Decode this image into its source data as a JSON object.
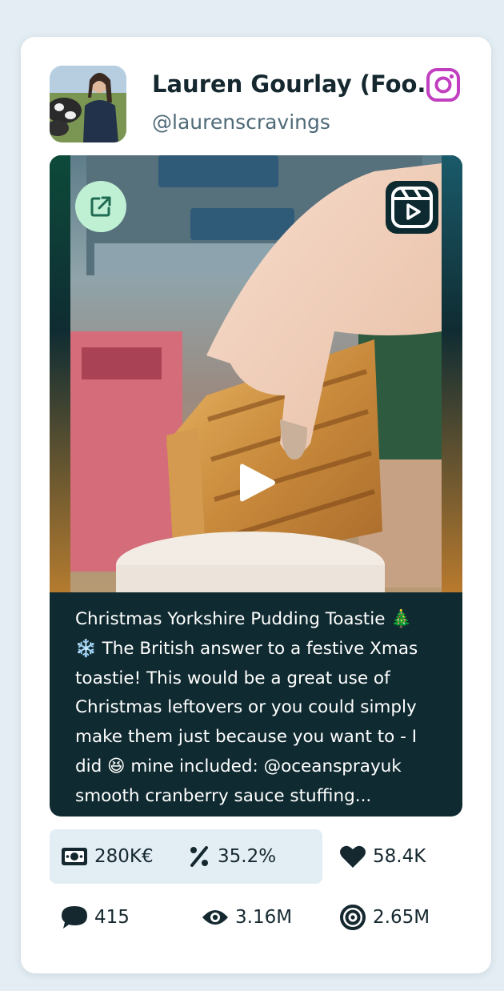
{
  "profile": {
    "name": "Lauren Gourlay (Foo...",
    "handle": "@laurenscravings",
    "platform_icon": "instagram-icon",
    "platform_color": "#c13ec0"
  },
  "media": {
    "type_icon": "reels-icon",
    "open_icon": "external-link-icon",
    "play_icon": "play-icon"
  },
  "caption": {
    "line1": "Christmas Yorkshire Pudding Toastie 🎄",
    "line2": "❄️ The British answer to a festive Xmas",
    "line3": "toastie! This would be a great use of",
    "line4": "Christmas leftovers or you could simply",
    "line5": "make them just because you want to - I",
    "line6": "did 😆 mine included: @oceansprayuk",
    "line7": "smooth cranberry sauce stuffing..."
  },
  "stats": {
    "cost": "280K€",
    "engagement_rate": "35.2%",
    "likes": "58.4K",
    "comments": "415",
    "views": "3.16M",
    "reach": "2.65M"
  },
  "colors": {
    "accent_green": "#bff0d4",
    "caption_bg": "#0f2a30",
    "highlight_bg": "#e3eef4",
    "text_dark": "#15282f"
  }
}
